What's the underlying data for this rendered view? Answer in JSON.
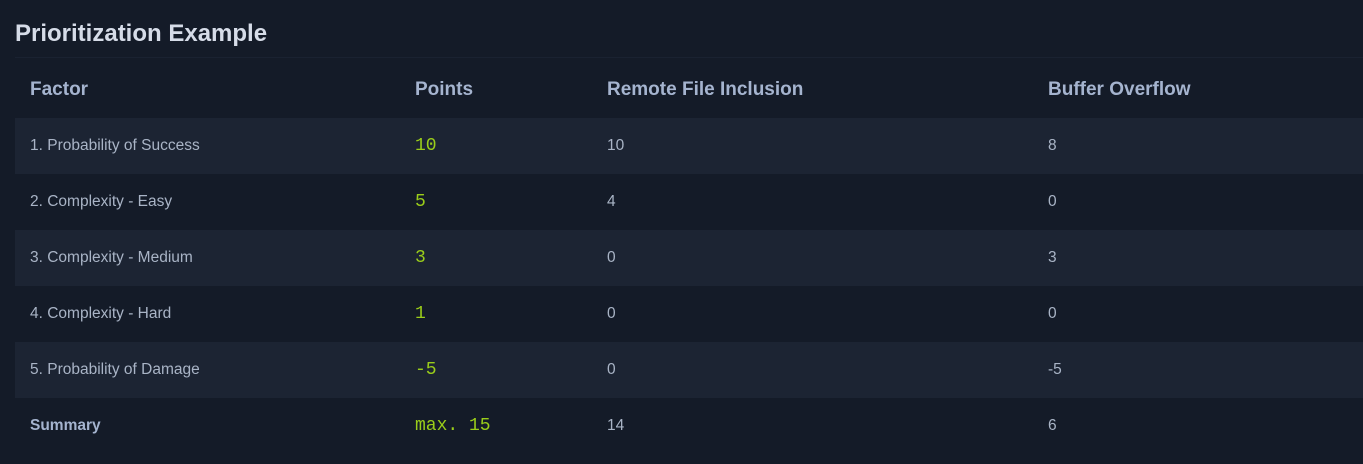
{
  "title": "Prioritization Example",
  "table": {
    "headers": [
      "Factor",
      "Points",
      "Remote File Inclusion",
      "Buffer Overflow"
    ],
    "rows": [
      {
        "factor": "1. Probability of Success",
        "points": "10",
        "rfi": "10",
        "bo": "8"
      },
      {
        "factor": "2. Complexity - Easy",
        "points": "5",
        "rfi": "4",
        "bo": "0"
      },
      {
        "factor": "3. Complexity - Medium",
        "points": "3",
        "rfi": "0",
        "bo": "3"
      },
      {
        "factor": "4. Complexity - Hard",
        "points": "1",
        "rfi": "0",
        "bo": "0"
      },
      {
        "factor": "5. Probability of Damage",
        "points": "-5",
        "rfi": "0",
        "bo": "-5"
      }
    ],
    "summary": {
      "factor": "Summary",
      "points": "max. 15",
      "rfi": "14",
      "bo": "6"
    }
  },
  "colors": {
    "background": "#141b28",
    "row_alt": "#1c2433",
    "points_accent": "#9acd1a",
    "header_text": "#a5b4cf"
  }
}
